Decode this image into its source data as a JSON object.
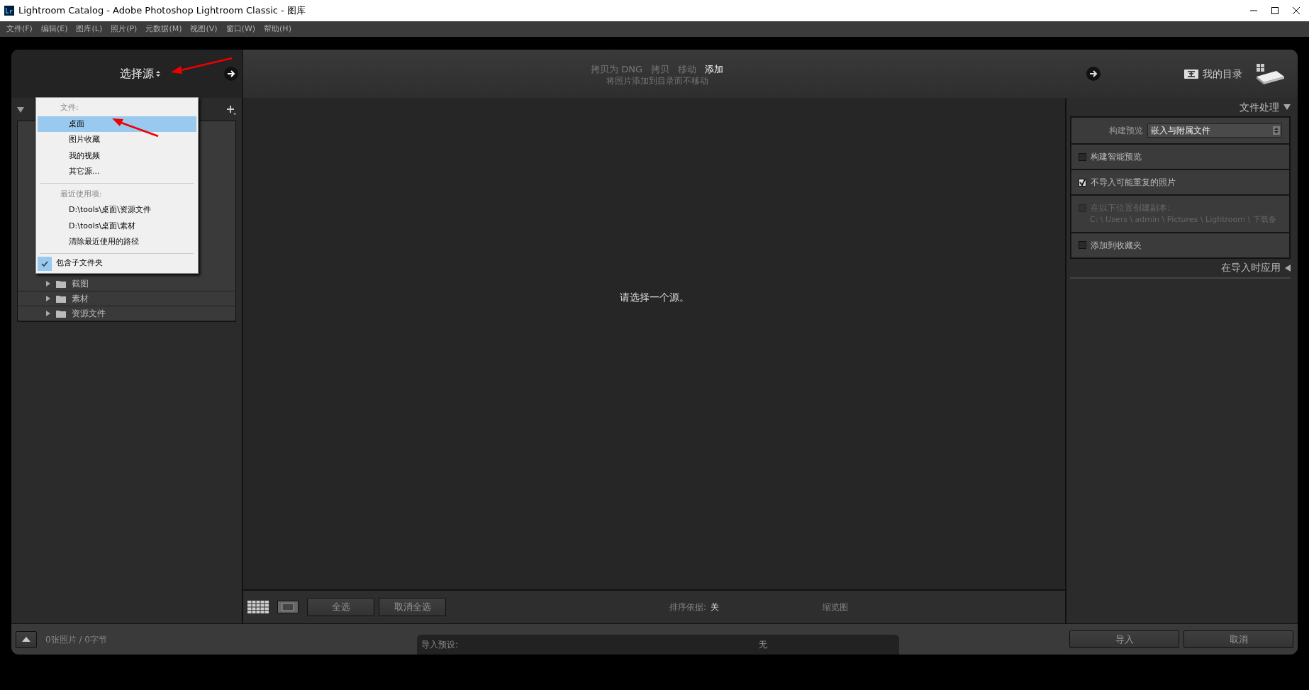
{
  "window": {
    "title": "Lightroom Catalog - Adobe Photoshop Lightroom Classic - 图库"
  },
  "menu": [
    "文件(F)",
    "编辑(E)",
    "图库(L)",
    "照片(P)",
    "元数据(M)",
    "视图(V)",
    "窗口(W)",
    "帮助(H)"
  ],
  "source": {
    "label": "选择源"
  },
  "modes": [
    {
      "label": "拷贝为 DNG",
      "selected": false
    },
    {
      "label": "拷贝",
      "selected": false
    },
    {
      "label": "移动",
      "selected": false
    },
    {
      "label": "添加",
      "selected": true
    }
  ],
  "mode_description": "将照片添加到目录而不移动",
  "destination": {
    "label": "我的目录"
  },
  "source_menu": {
    "sections": [
      {
        "heading": "文件:",
        "items": [
          {
            "label": "桌面",
            "selected": true
          },
          {
            "label": "图片收藏",
            "selected": false
          },
          {
            "label": "我的视频",
            "selected": false
          },
          {
            "label": "其它源...",
            "selected": false
          }
        ]
      },
      {
        "heading": "最近使用项:",
        "items": [
          {
            "label": "D:\\tools\\桌面\\资源文件",
            "selected": false
          },
          {
            "label": "D:\\tools\\桌面\\素材",
            "selected": false
          },
          {
            "label": "清除最近使用的路径",
            "selected": false
          }
        ]
      }
    ],
    "include_subfolders": {
      "label": "包含子文件夹",
      "checked": true
    }
  },
  "folders": [
    {
      "name": "截图"
    },
    {
      "name": "素材"
    },
    {
      "name": "资源文件"
    }
  ],
  "center_message": "请选择一个源。",
  "toolbar": {
    "buttons": [
      "全选",
      "取消全选"
    ],
    "sort_label": "排序依据:",
    "sort_value": "关",
    "thumbnail_label": "缩览图"
  },
  "status": "0张照片 / 0字节",
  "import_preset": {
    "label": "导入预设:",
    "value": "无"
  },
  "actions": [
    "导入",
    "取消"
  ],
  "file_handling": {
    "title": "文件处理",
    "build_previews": {
      "label": "构建预览",
      "value": "嵌入与附属文件"
    },
    "options": [
      {
        "label": "构建智能预览",
        "checked": false,
        "disabled": false
      },
      {
        "label": "不导入可能重复的照片",
        "checked": true,
        "disabled": false
      },
      {
        "label": "在以下位置创建副本:",
        "checked": false,
        "disabled": true,
        "path": "C: \\ Users \\ admin \\ Pictures \\ Lightroom \\ 下载备"
      },
      {
        "label": "添加到收藏夹",
        "checked": false,
        "disabled": false
      }
    ]
  },
  "apply_during_import": {
    "title": "在导入时应用"
  }
}
